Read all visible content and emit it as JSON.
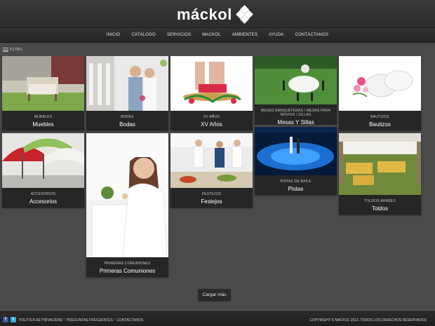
{
  "brand": {
    "name": "máckol"
  },
  "nav": [
    "Inicio",
    "Catálogo",
    "Servicios",
    "Mackol",
    "Ambientes",
    "Ayuda",
    "Contáctanos"
  ],
  "filter": {
    "label": "FILTRO"
  },
  "cards": [
    {
      "category": "Muebles",
      "title": "Muebles"
    },
    {
      "category": "Bodas",
      "title": "Bodas"
    },
    {
      "category": "XV Años",
      "title": "XV Años"
    },
    {
      "category": "Mesas Banqueteras / Mesas para Novios / Sillas",
      "title": "Mesas Y Sillas"
    },
    {
      "category": "Bautizos",
      "title": "Bautizos"
    },
    {
      "category": "Accesorios",
      "title": "Accesorios"
    },
    {
      "category": "Festejos",
      "title": "Festejos"
    },
    {
      "category": "Pistas de Baile",
      "title": "Pistas"
    },
    {
      "category": "Toldos Árabes",
      "title": "Toldos"
    },
    {
      "category": "Primeras Comuniones",
      "title": "Primeras Comuniones"
    }
  ],
  "load_more": "Cargar más",
  "footer": {
    "links": [
      "Política de Privacidad",
      "Preguntas Frecuentes",
      "Contáctanos"
    ],
    "copyright": "Copyright © Mackol 2013. Todos los derechos reservados",
    "social": [
      "f",
      "t"
    ]
  },
  "colors": {
    "facebook": "#3b5998",
    "twitter": "#29a9e0",
    "background": "#4a4a4a",
    "card": "#262626"
  }
}
